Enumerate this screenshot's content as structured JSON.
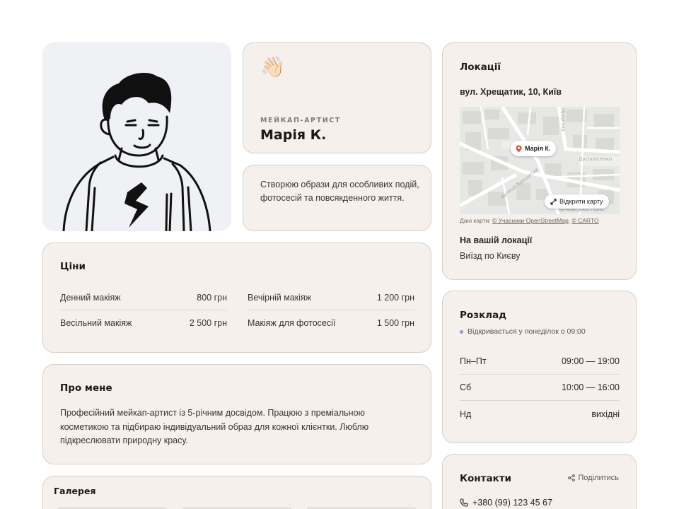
{
  "profile": {
    "role": "мейкап-артист",
    "name": "Марія К.",
    "wave": "👋🏻",
    "tagline": "Створюю образи для особливих подій, фотосесій та повсякденного життя."
  },
  "prices": {
    "title": "Ціни",
    "items": [
      {
        "name": "Денний макіяж",
        "price": "800 грн"
      },
      {
        "name": "Вечірній макіяж",
        "price": "1 200 грн"
      },
      {
        "name": "Весільний макіяж",
        "price": "2 500 грн"
      },
      {
        "name": "Макіяж для фотосесії",
        "price": "1 500 грн"
      }
    ]
  },
  "about": {
    "title": "Про мене",
    "text": "Професійний мейкап-артист із 5-річним досвідом. Працюю з преміальною косметикою та підбираю індивідуальний образ для кожної клієнтки. Люблю підкреслювати природну красу."
  },
  "gallery": {
    "title": "Галерея"
  },
  "locations": {
    "title": "Локації",
    "address": "вул. Хрещатик, 10, Київ",
    "map": {
      "pin_label": "Марія К.",
      "open_label": "Відкрити карту",
      "street_labels": [
        "вулиця Хрещатик",
        "Дусішосенко",
        "БЕЧЕВСЬКА ГОРА",
        "Прорізна"
      ],
      "attribution_prefix": "Дані карти: ",
      "attribution_osm": "© Учасники OpenStreetMap",
      "attribution_sep": ", ",
      "attribution_carto": "© CARTO"
    },
    "at_your_location_title": "На вашій локації",
    "at_your_location_text": "Виїзд по Києву"
  },
  "schedule": {
    "title": "Розклад",
    "status": "Відкривається у понеділок о 09:00",
    "status_color": "#8d9fb5",
    "rows": [
      {
        "day": "Пн–Пт",
        "hours": "09:00 — 19:00"
      },
      {
        "day": "Сб",
        "hours": "10:00 — 16:00"
      },
      {
        "day": "Нд",
        "hours": "вихідні"
      }
    ]
  },
  "contacts": {
    "title": "Контакти",
    "share_label": "Поділитись",
    "phone": "+380 (99) 123 45 67"
  },
  "icons": {
    "share": "share-icon",
    "phone": "phone-icon",
    "pin": "map-pin-icon",
    "expand": "expand-icon",
    "wave": "waving-hand-icon"
  },
  "colors": {
    "card_bg": "#f5f0ec",
    "card_border": "#d6d0cb",
    "pin": "#e0553b"
  }
}
